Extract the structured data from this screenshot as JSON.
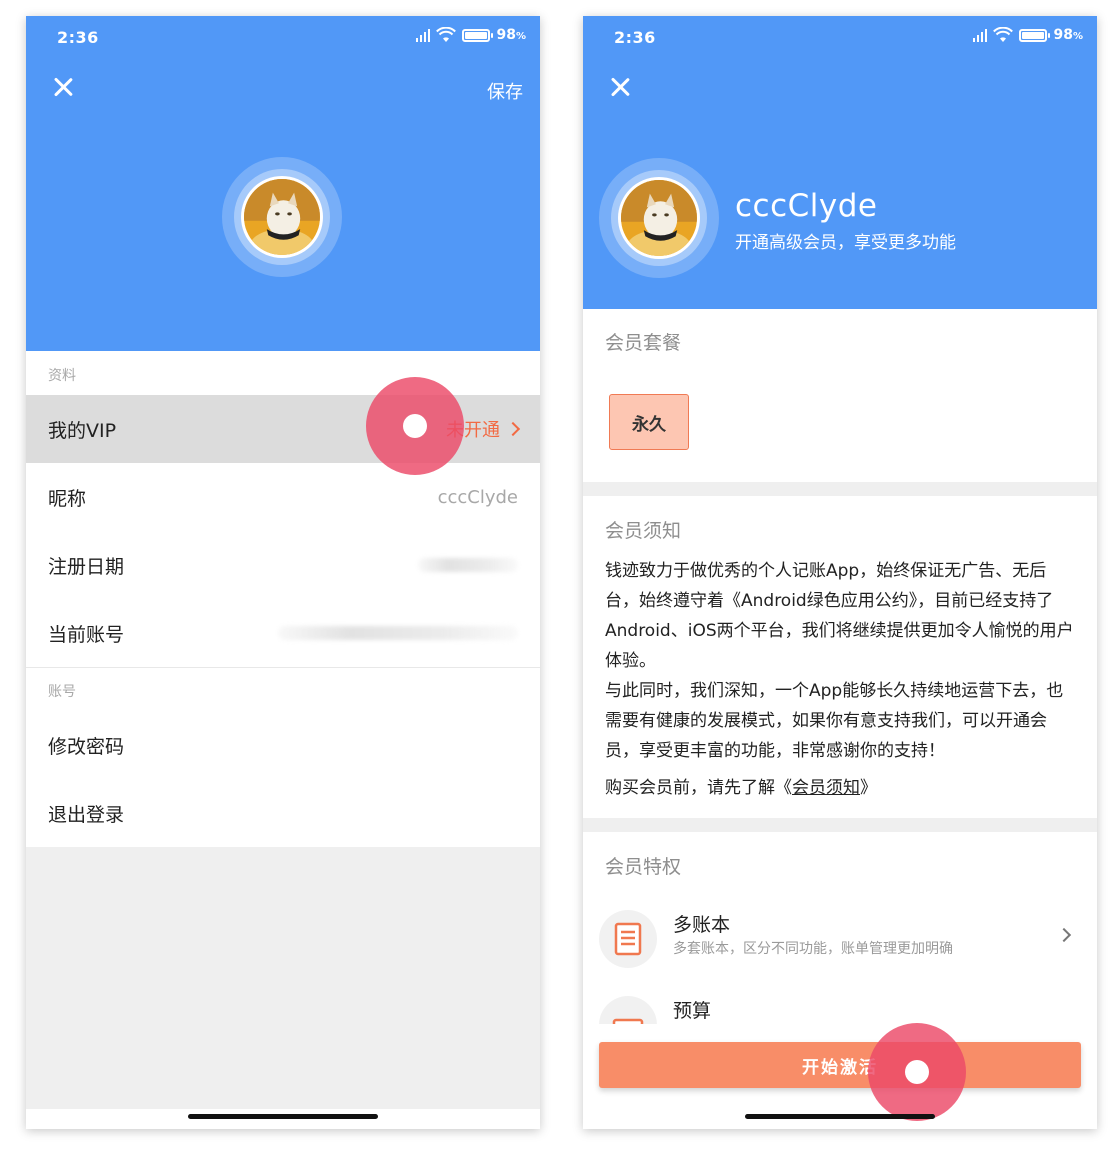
{
  "status_bar": {
    "time": "2:36",
    "battery": "98",
    "battery_unit": "%",
    "battery_level": 0.98
  },
  "left_screen": {
    "save_label": "保存",
    "section_profile": "资料",
    "rows_profile": [
      {
        "label": "我的VIP",
        "value": "未开通"
      },
      {
        "label": "昵称",
        "value": "cccClyde"
      },
      {
        "label": "注册日期",
        "value": ""
      },
      {
        "label": "当前账号",
        "value": ""
      }
    ],
    "section_account": "账号",
    "rows_account": [
      {
        "label": "修改密码"
      },
      {
        "label": "退出登录"
      }
    ]
  },
  "right_screen": {
    "username": "cccClyde",
    "subtitle": "开通高级会员，享受更多功能",
    "plans_title": "会员套餐",
    "plan_option": "永久",
    "notice_title": "会员须知",
    "notice_para1": "钱迹致力于做优秀的个人记账App，始终保证无广告、无后台，始终遵守着《Android绿色应用公约》，目前已经支持了Android、iOS两个平台，我们将继续提供更加令人愉悦的用户体验。",
    "notice_para2": "与此同时，我们深知，一个App能够长久持续地运营下去，也需要有健康的发展模式，如果你有意支持我们，可以开通会员，享受更丰富的功能，非常感谢你的支持！",
    "notice_prefix": "购买会员前，请先了解《",
    "notice_link": "会员须知",
    "notice_suffix": "》",
    "perks_title": "会员特权",
    "perks": [
      {
        "title": "多账本",
        "desc": "多套账本，区分不同功能，账单管理更加明确",
        "icon": "ledger-icon"
      },
      {
        "title": "预算",
        "desc": "",
        "icon": "budget-icon"
      }
    ],
    "activate_label": "开始激活"
  },
  "colors": {
    "header_blue": "#5198f7",
    "accent_orange": "#f26a43",
    "button_orange": "#f88d68",
    "touch_pink": "#ec4968"
  }
}
